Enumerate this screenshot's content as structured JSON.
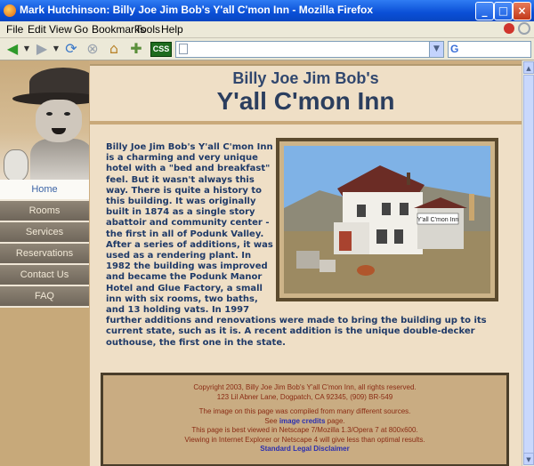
{
  "window": {
    "title": "Mark Hutchinson: Billy Joe Jim Bob's Y'all C'mon Inn - Mozilla Firefox"
  },
  "menu": {
    "items": [
      "File",
      "Edit",
      "View",
      "Go",
      "Bookmarks",
      "Tools",
      "Help"
    ]
  },
  "toolbar": {
    "css_label": "CSS",
    "url_value": ""
  },
  "site": {
    "title_line1": "Billy Joe Jim Bob's",
    "title_line2": "Y'all C'mon Inn",
    "nav": [
      "Home",
      "Rooms",
      "Services",
      "Reservations",
      "Contact Us",
      "FAQ"
    ],
    "active_nav": "Home",
    "body_text": "Billy Joe Jim Bob's Y'all C'mon Inn is a charming and very unique hotel with a \"bed and breakfast\" feel. But it wasn't always this way. There is quite a history to this building. It was originally built in 1874 as a single story abattoir and community center - the first in all of Podunk Valley. After a series of additions, it was used as a rendering plant. In 1982 the building was improved and became the Podunk Manor Hotel and Glue Factory, a small inn with six rooms, two baths, and 13 holding vats. In 1997 further additions and renovations were made to bring the building up to its current state, such as it is. A recent addition is the unique double-decker outhouse, the first one in the state.",
    "photo_sign": "Y'all C'mon Inn"
  },
  "footer": {
    "copyright": "Copyright 2003, Billy Joe Jim Bob's Y'all C'mon Inn, all rights reserved.",
    "address": "123 Lil Abner Lane, Dogpatch, CA 92345, (909) BR-549",
    "image_note": "The image on this page was compiled from many different sources.",
    "see_prefix": "See",
    "image_credits_link": "image credits",
    "see_suffix": "page.",
    "best_viewed": "This page is best viewed in Netscape 7/Mozilla 1.3/Opera 7 at 800x600.",
    "viewing_note": "Viewing in Internet Explorer or Netscape 4 will give less than optimal results.",
    "disclaimer_link": "Standard Legal Disclaimer"
  }
}
